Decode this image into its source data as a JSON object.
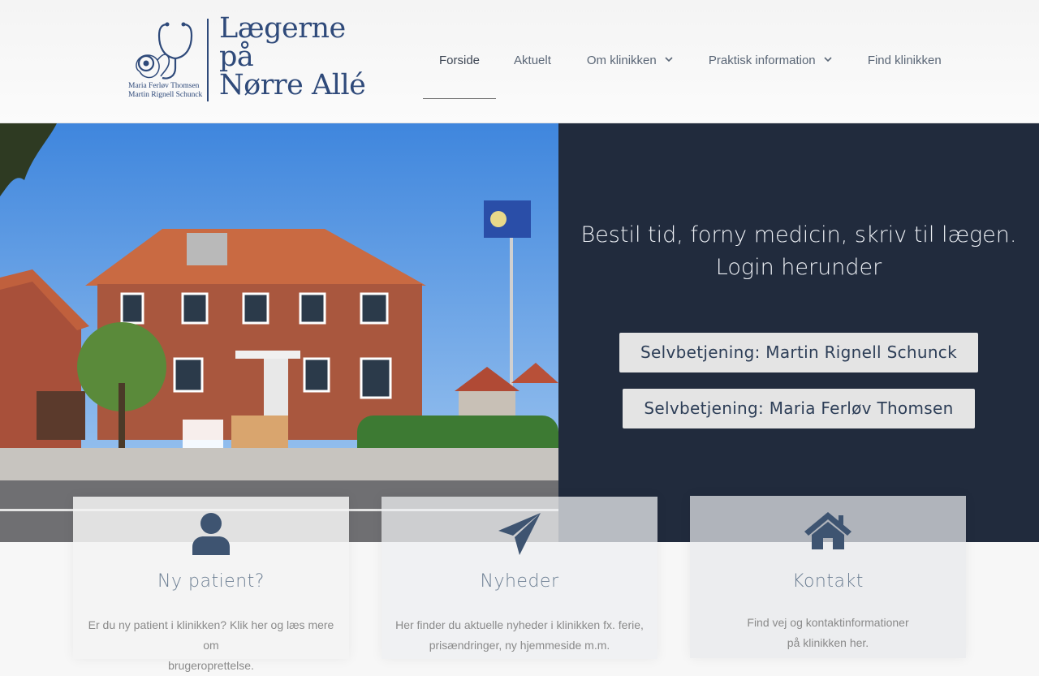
{
  "logo": {
    "title_lines": [
      "Lægerne",
      "på",
      "Nørre Allé"
    ],
    "names": [
      "Maria Ferløv Thomsen",
      "Martin Rignell Schunck"
    ]
  },
  "nav": {
    "items": [
      {
        "label": "Forside",
        "active": true
      },
      {
        "label": "Aktuelt"
      },
      {
        "label": "Om klinikken",
        "dropdown": true
      },
      {
        "label": "Praktisk information",
        "dropdown": true
      },
      {
        "label": "Find klinikken"
      }
    ]
  },
  "hero": {
    "heading_line1": "Bestil tid, forny medicin, skriv til lægen.",
    "heading_line2": "Login herunder",
    "button_1": "Selvbetjening: Martin Rignell Schunck",
    "button_2": "Selvbetjening: Maria Ferløv Thomsen",
    "panel_color": "#212b3d"
  },
  "cards": [
    {
      "icon": "user-icon",
      "title": "Ny patient?",
      "text_line1": "Er du ny patient i klinikken? Klik her og læs mere om",
      "text_line2": "brugeroprettelse."
    },
    {
      "icon": "paper-plane-icon",
      "title": "Nyheder",
      "text_line1": "Her finder du aktuelle nyheder i klinikken fx. ferie,",
      "text_line2": "prisændringer, ny hjemmeside m.m."
    },
    {
      "icon": "home-icon",
      "title": "Kontakt",
      "text_line1": "Find vej og kontaktinformationer",
      "text_line2": "på klinikken her."
    }
  ],
  "colors": {
    "brand_blue": "#2f4a7a",
    "icon_color": "#3e5471",
    "button_bg": "#e4e4e4"
  }
}
